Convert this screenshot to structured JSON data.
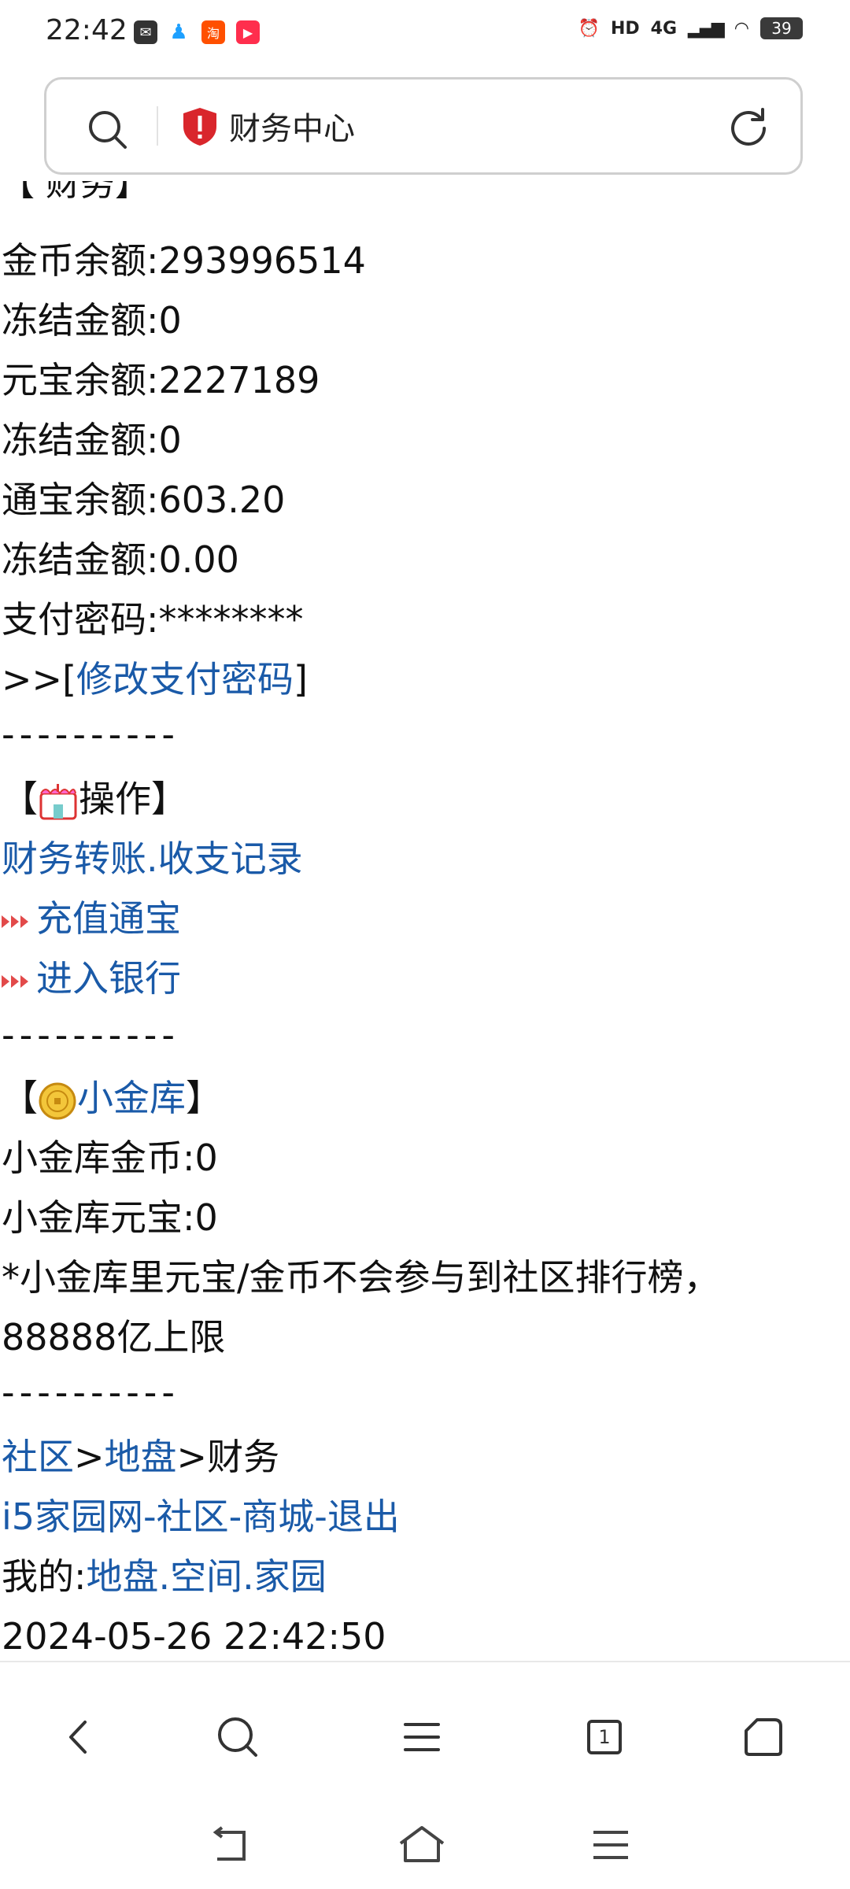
{
  "status_bar": {
    "time": "22:42",
    "battery": "39",
    "network": "4G",
    "hd": "HD"
  },
  "address_bar": {
    "title": "财务中心"
  },
  "content": {
    "section_cut": "【  财务】",
    "lines": {
      "coins": "金币余额:293996514",
      "frozen1": "冻结金额:0",
      "yuanbao": "元宝余额:2227189",
      "frozen2": "冻结金额:0",
      "tongbao": "通宝余额:603.20",
      "frozen3": "冻结金额:0.00",
      "pay_pwd": "支付密码:********",
      "modify_prefix": ">>[",
      "modify_link": "修改支付密码",
      "modify_suffix": "]",
      "dashes": "----------",
      "ops_open": "【",
      "ops_title": "操作",
      "ops_close": "】",
      "transfer_link": "财务转账",
      "dot": ".",
      "records_link": "收支记录",
      "recharge_link": "充值通宝",
      "bank_link": "进入银行",
      "vault_open": "【",
      "vault_link": "小金库",
      "vault_close": "】",
      "vault_coins": "小金库金币:0",
      "vault_yuanbao": "小金库元宝:0",
      "vault_note1": "*小金库里元宝/金币不会参与到社区排行榜，",
      "vault_note2": "88888亿上限",
      "bc_community": "社区",
      "bc_sep": ">",
      "bc_territory": "地盘",
      "bc_current": ">财务",
      "site_link": "i5家园网",
      "hyphen": "-",
      "community_link": "社区",
      "mall_link": "商城",
      "logout_link": "退出",
      "mine_prefix": "我的:",
      "my_territory": "地盘",
      "my_space": "空间",
      "my_home": "家园",
      "timestamp": "2024-05-26 22:42:50"
    }
  },
  "bottom_nav": {
    "tabs_count": "1"
  },
  "colors": {
    "link": "#1a5aa8",
    "shield": "#d9262c"
  }
}
